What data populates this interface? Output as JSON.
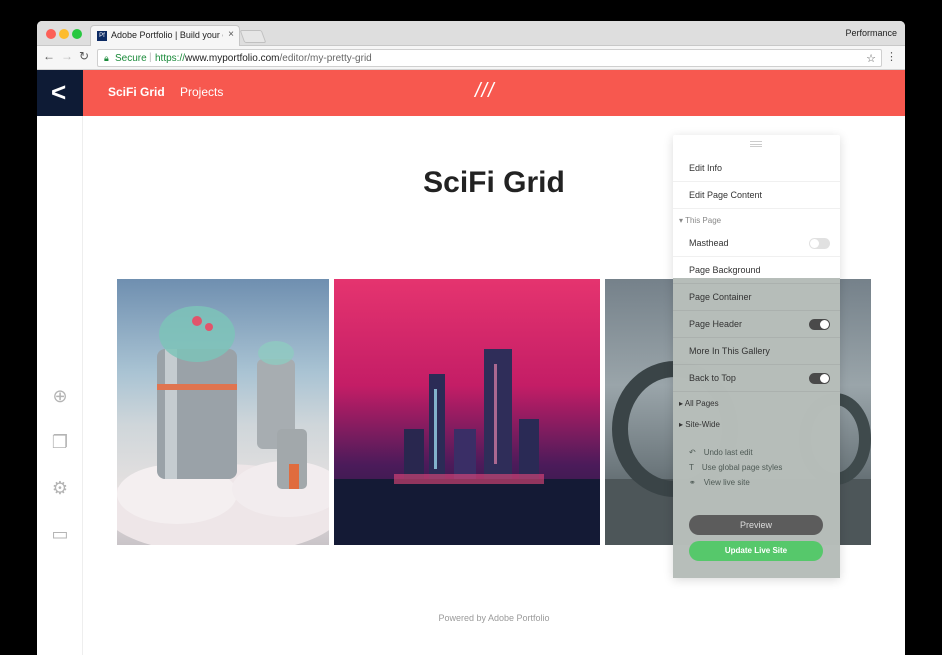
{
  "browser": {
    "tab_title": "Adobe Portfolio | Build your ow",
    "tab_favicon": "Pf",
    "tab_close": "×",
    "profile_name": "Performance",
    "secure_label": "Secure",
    "url_scheme": "https://",
    "url_host": "www.myportfolio.com",
    "url_path": "/editor/my-pretty-grid"
  },
  "header": {
    "site_name": "SciFi Grid",
    "projects_label": "Projects",
    "logo_mark": "///"
  },
  "page": {
    "title": "SciFi Grid",
    "powered_by": "Powered by Adobe Portfolio"
  },
  "panel": {
    "edit_info": "Edit Info",
    "edit_page_content": "Edit Page Content",
    "this_page": "This Page",
    "masthead": "Masthead",
    "page_background": "Page Background",
    "page_container": "Page Container",
    "page_header": "Page Header",
    "more_in_gallery": "More In This Gallery",
    "back_to_top": "Back to Top",
    "all_pages": "All Pages",
    "site_wide": "Site-Wide",
    "undo": "Undo last edit",
    "use_global": "Use global page styles",
    "view_live": "View live site",
    "preview": "Preview",
    "update_live": "Update Live Site"
  },
  "colors": {
    "header_bg": "#f7584f",
    "back_block": "#0e1b35",
    "update_green": "#56c86b"
  }
}
